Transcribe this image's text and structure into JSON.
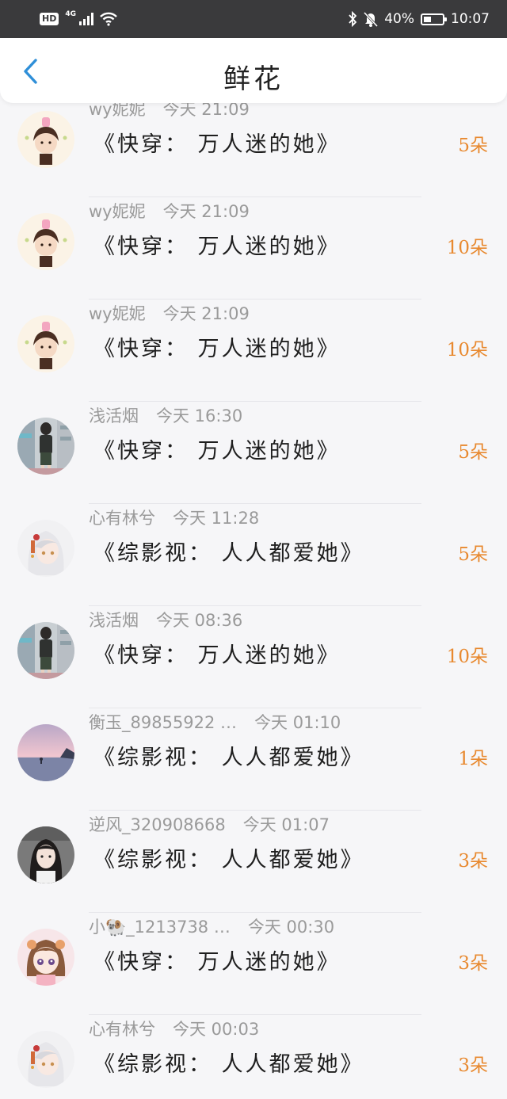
{
  "status_bar": {
    "hd": "HD",
    "network": "4G",
    "battery_percent": "40%",
    "battery_level": 0.4,
    "time": "10:07"
  },
  "header": {
    "title": "鲜花"
  },
  "colors": {
    "accent": "#2f8fd8",
    "count": "#e8892f",
    "meta": "#9a9a9a"
  },
  "records": [
    {
      "name": "wy妮妮",
      "time": "今天 21:09",
      "book": "《快穿： 万人迷的她》",
      "count": "5朵",
      "avatar": "anime-boy"
    },
    {
      "name": "wy妮妮",
      "time": "今天 21:09",
      "book": "《快穿： 万人迷的她》",
      "count": "10朵",
      "avatar": "anime-boy"
    },
    {
      "name": "wy妮妮",
      "time": "今天 21:09",
      "book": "《快穿： 万人迷的她》",
      "count": "10朵",
      "avatar": "anime-boy"
    },
    {
      "name": "浅活烟",
      "time": "今天 16:30",
      "book": "《快穿： 万人迷的她》",
      "count": "5朵",
      "avatar": "photo-girl"
    },
    {
      "name": "心有林兮",
      "time": "今天 11:28",
      "book": "《综影视： 人人都爱她》",
      "count": "5朵",
      "avatar": "anime-white-hair"
    },
    {
      "name": "浅活烟",
      "time": "今天 08:36",
      "book": "《快穿： 万人迷的她》",
      "count": "10朵",
      "avatar": "photo-girl"
    },
    {
      "name": "衡玉_89855922 …",
      "time": "今天 01:10",
      "book": "《综影视： 人人都爱她》",
      "count": "1朵",
      "avatar": "sunset"
    },
    {
      "name": "逆风_320908668",
      "time": "今天 01:07",
      "book": "《综影视： 人人都爱她》",
      "count": "3朵",
      "avatar": "selfie"
    },
    {
      "name": "小🐏_1213738 …",
      "time": "今天 00:30",
      "book": "《快穿： 万人迷的她》",
      "count": "3朵",
      "avatar": "anime-girl"
    },
    {
      "name": "心有林兮",
      "time": "今天 00:03",
      "book": "《综影视： 人人都爱她》",
      "count": "3朵",
      "avatar": "anime-white-hair"
    }
  ]
}
